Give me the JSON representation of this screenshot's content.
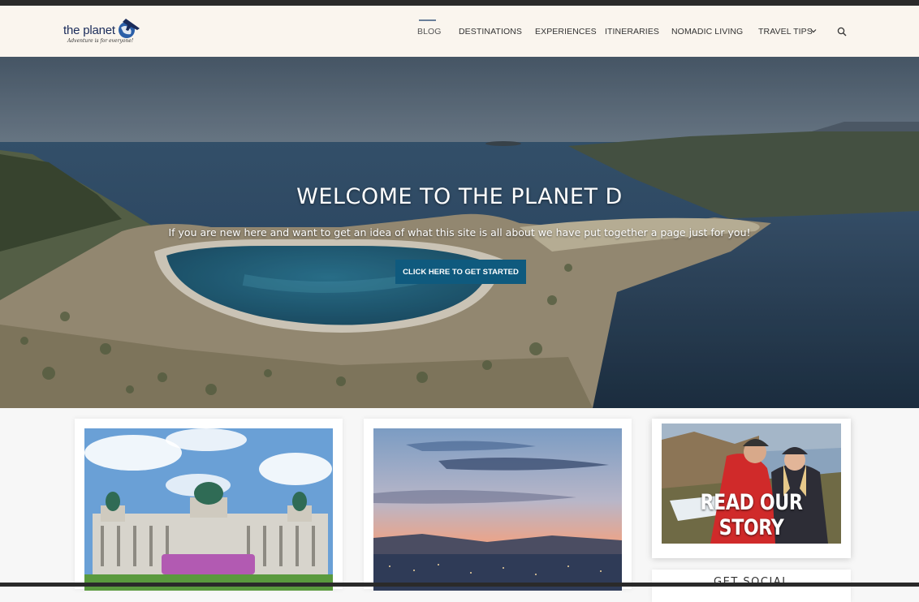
{
  "site": {
    "logo_text": "the planet",
    "logo_tagline": "Adventure is for everyone!"
  },
  "nav": {
    "items": [
      {
        "label": "Blog",
        "active": true
      },
      {
        "label": "Destinations"
      },
      {
        "label": "Experiences"
      },
      {
        "label": "Itineraries"
      },
      {
        "label": "Nomadic Living"
      },
      {
        "label": "Travel Tips",
        "has_dropdown": true
      }
    ],
    "search_icon": "search-icon"
  },
  "hero": {
    "title": "WELCOME TO THE PLANET D",
    "subtitle": "If you are new here and want to get an idea of what this site is all about we have put together a page just for you!",
    "button_label": "CLICK HERE TO GET STARTED"
  },
  "sidebar": {
    "story_label": "READ OUR STORY",
    "social_label": "GET SOCIAL"
  },
  "colors": {
    "header_bg": "#faf5ee",
    "button_bg": "#0f5a7e",
    "nav_text": "#333333"
  }
}
